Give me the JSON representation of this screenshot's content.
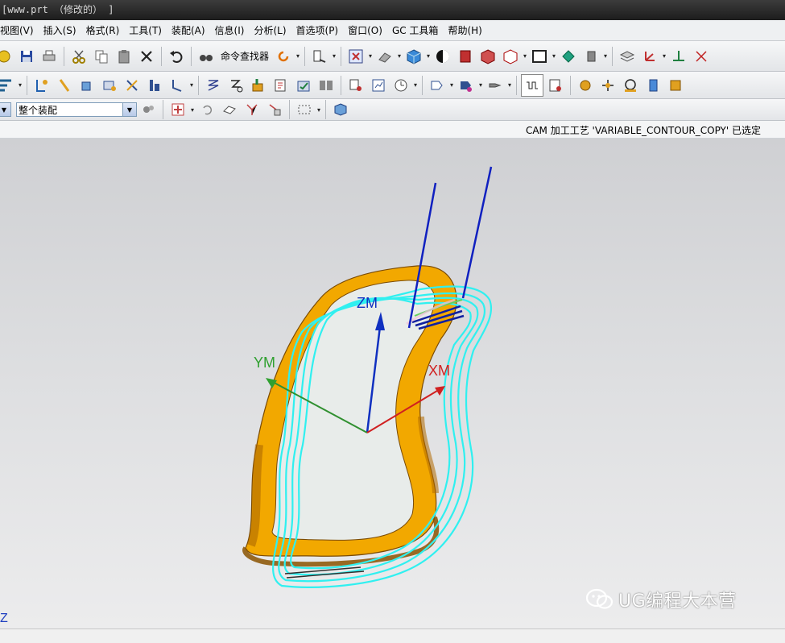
{
  "window": {
    "title": "[www.prt （修改的） ]"
  },
  "menu": {
    "items": [
      "视图(V)",
      "插入(S)",
      "格式(R)",
      "工具(T)",
      "装配(A)",
      "信息(I)",
      "分析(L)",
      "首选项(P)",
      "窗口(O)",
      "GC 工具箱",
      "帮助(H)"
    ]
  },
  "toolbar": {
    "command_finder": "命令查找器"
  },
  "assembly": {
    "selected": "整个装配"
  },
  "status": {
    "message": "CAM 加工工艺 'VARIABLE_CONTOUR_COPY' 已选定"
  },
  "viewport": {
    "axes": {
      "z": "ZM",
      "y": "YM",
      "x": "XM"
    },
    "corner_label": "Z",
    "colors": {
      "part": "#f0a800",
      "toolpath": "#30f0f0",
      "tool_axis": "#1020c0",
      "x_axis": "#d02020",
      "y_axis": "#309030",
      "z_axis": "#1030c0"
    }
  },
  "watermark": {
    "text": "UG编程大本营",
    "icon": "wechat-icon"
  }
}
